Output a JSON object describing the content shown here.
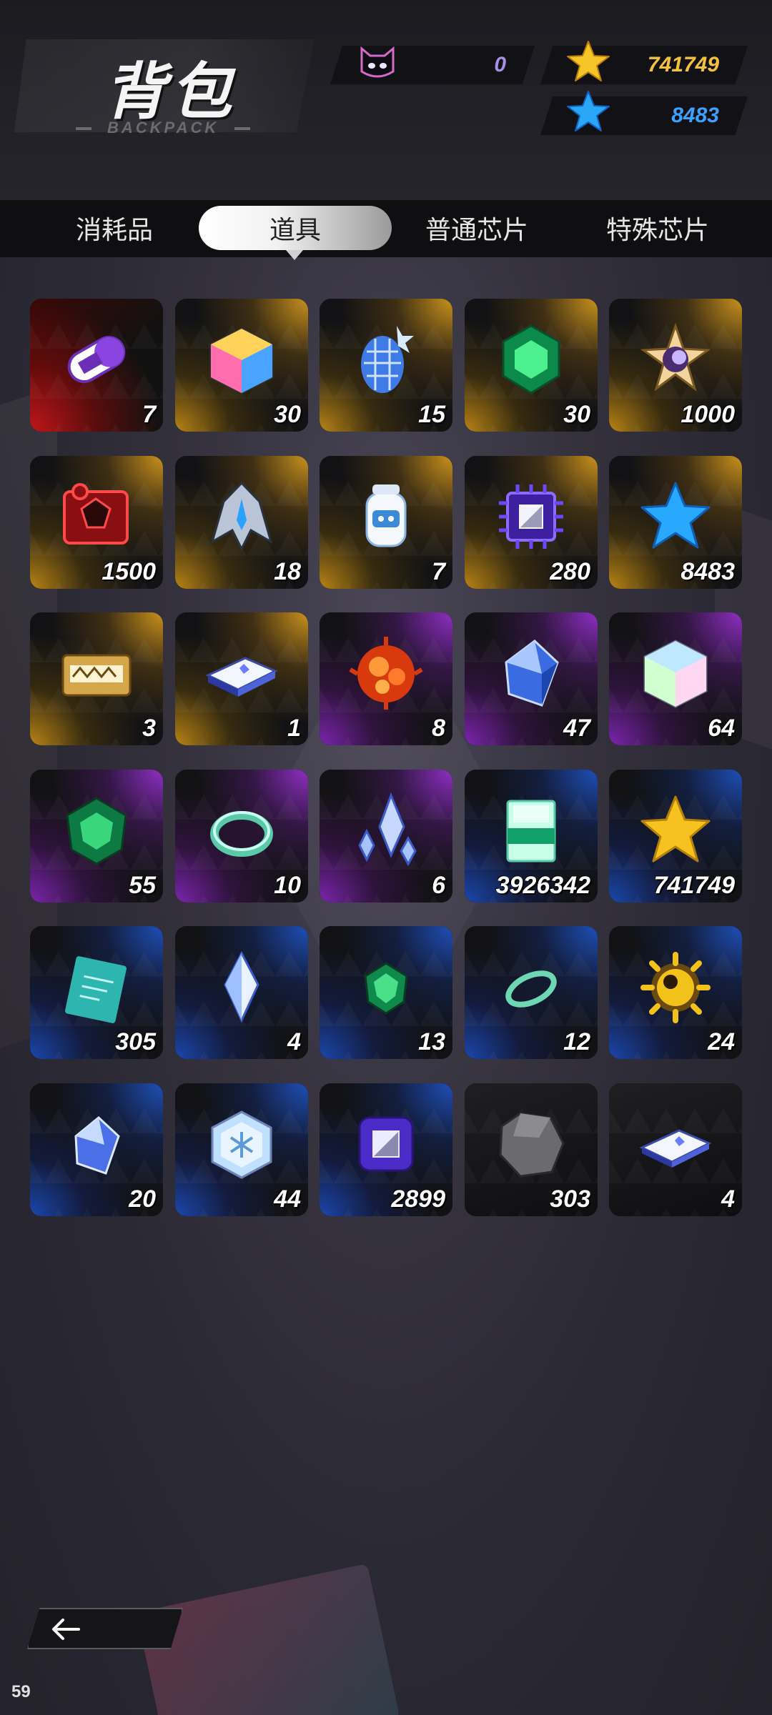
{
  "header": {
    "title": "背包",
    "subtitle": "BACKPACK",
    "cat_currency": "0",
    "gold_stars": "741749",
    "blue_stars": "8483"
  },
  "tabs": [
    {
      "label": "消耗品",
      "active": false
    },
    {
      "label": "道具",
      "active": true
    },
    {
      "label": "普通芯片",
      "active": false
    },
    {
      "label": "特殊芯片",
      "active": false
    }
  ],
  "items": [
    {
      "icon": "capsule-icon",
      "count": "7",
      "rarity": "red"
    },
    {
      "icon": "cube-icon",
      "count": "30",
      "rarity": "gold"
    },
    {
      "icon": "crystal-pine-icon",
      "count": "15",
      "rarity": "gold"
    },
    {
      "icon": "green-gem-icon",
      "count": "30",
      "rarity": "gold"
    },
    {
      "icon": "star-badge-icon",
      "count": "1000",
      "rarity": "gold"
    },
    {
      "icon": "red-puzzle-icon",
      "count": "1500",
      "rarity": "gold"
    },
    {
      "icon": "mech-wing-icon",
      "count": "18",
      "rarity": "gold"
    },
    {
      "icon": "robot-jar-icon",
      "count": "7",
      "rarity": "gold"
    },
    {
      "icon": "purple-chip-icon",
      "count": "280",
      "rarity": "gold"
    },
    {
      "icon": "blue-star-icon",
      "count": "8483",
      "rarity": "gold"
    },
    {
      "icon": "gold-ticket-icon",
      "count": "3",
      "rarity": "gold"
    },
    {
      "icon": "plate-icon",
      "count": "1",
      "rarity": "gold"
    },
    {
      "icon": "red-coral-icon",
      "count": "8",
      "rarity": "purple"
    },
    {
      "icon": "blue-crystal-icon",
      "count": "47",
      "rarity": "purple"
    },
    {
      "icon": "prism-cube-icon",
      "count": "64",
      "rarity": "purple"
    },
    {
      "icon": "emerald-icon",
      "count": "55",
      "rarity": "purple"
    },
    {
      "icon": "ring-icon",
      "count": "10",
      "rarity": "purple"
    },
    {
      "icon": "crystal-shards-icon",
      "count": "6",
      "rarity": "purple"
    },
    {
      "icon": "crystal-block-icon",
      "count": "3926342",
      "rarity": "blue"
    },
    {
      "icon": "gold-star-icon",
      "count": "741749",
      "rarity": "blue"
    },
    {
      "icon": "blueprint-icon",
      "count": "305",
      "rarity": "blue"
    },
    {
      "icon": "diamond-shard-icon",
      "count": "4",
      "rarity": "blue"
    },
    {
      "icon": "small-emerald-icon",
      "count": "13",
      "rarity": "blue"
    },
    {
      "icon": "thin-ring-icon",
      "count": "12",
      "rarity": "blue"
    },
    {
      "icon": "spiky-orb-icon",
      "count": "24",
      "rarity": "blue"
    },
    {
      "icon": "small-crystal-icon",
      "count": "20",
      "rarity": "blue"
    },
    {
      "icon": "snowflake-hex-icon",
      "count": "44",
      "rarity": "blue"
    },
    {
      "icon": "violet-chip-icon",
      "count": "2899",
      "rarity": "blue"
    },
    {
      "icon": "stone-icon",
      "count": "303",
      "rarity": "gray"
    },
    {
      "icon": "plate-small-icon",
      "count": "4",
      "rarity": "gray"
    }
  ],
  "fps": "59",
  "colors": {
    "gold": "#f3c23d",
    "blue": "#3ea1ff",
    "purple": "#a690e6"
  }
}
